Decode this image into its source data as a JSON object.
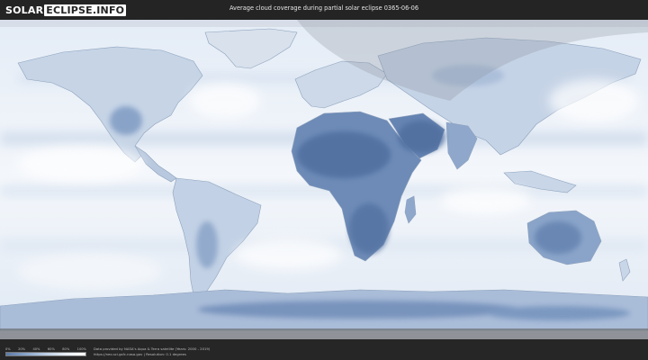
{
  "header": {
    "logo_part1": "SOLAR",
    "logo_part2": "ECLIPSE.INFO",
    "title": "Average cloud coverage during partial solar eclipse 0365-06-06"
  },
  "legend": {
    "ticks": [
      "0%",
      "20%",
      "40%",
      "60%",
      "80%",
      "100%"
    ],
    "gradient_colors": [
      "#5b7aa8",
      "#8aa6cc",
      "#bccfe6",
      "#e8eef7",
      "#ffffff"
    ]
  },
  "footer": {
    "credit_line1": "Data provided by NASA's Aqua & Terra satellite (Years: 2000 - 2019)",
    "credit_line2": "https://neo.sci.gsfc.nasa.gov | Resolution: 0.1 degrees"
  },
  "colors": {
    "ocean_cloudy": "#eef3f9",
    "clear_land": "#5a78a6",
    "coastline": "#8da2bd",
    "night_shade": "#9aa0a8"
  }
}
